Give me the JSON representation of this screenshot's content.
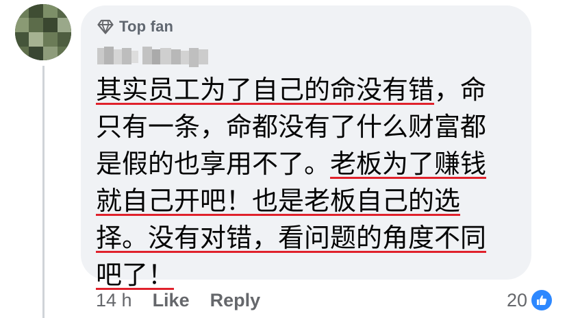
{
  "comment": {
    "badge": {
      "icon": "diamond-icon",
      "label": "Top fan"
    },
    "author": {
      "name": "",
      "avatar": "avatar"
    },
    "text_lines": [
      [
        "其实员工为了自己的命没有错",
        "，命"
      ],
      [
        "只有一条，命都没有了什么财富都"
      ],
      [
        "是假的也享用不了。",
        "老板为了赚钱"
      ],
      [
        "就自己开吧！也是老板自己的选"
      ],
      [
        "择。没有对错，看问题的角度不同"
      ],
      [
        "吧了！"
      ]
    ],
    "underline_color": "#e0212b"
  },
  "actions": {
    "timestamp": "14 h",
    "like_label": "Like",
    "reply_label": "Reply"
  },
  "reactions": {
    "count": "20",
    "icon": "like-icon",
    "color": "#2d88ff"
  }
}
